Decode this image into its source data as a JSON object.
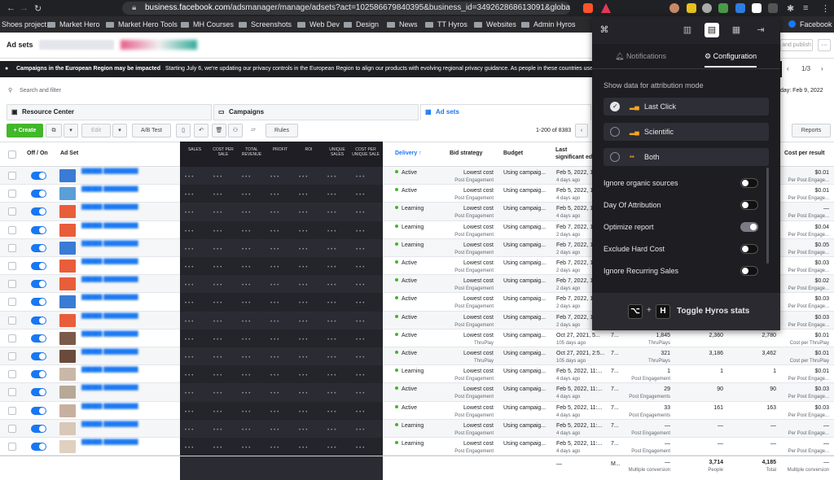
{
  "browser": {
    "url_host": "business.facebook.com",
    "url_path": "/adsmanager/manage/adsets?act=102586679840395&business_id=349262868613091&global...",
    "bookmarks": [
      "Shoes project",
      "Market Hero",
      "Market Hero Tools",
      "MH Courses",
      "Screenshots",
      "Web Dev",
      "Design",
      "News",
      "TT Hyros",
      "Websites",
      "Admin Hyros",
      "Facebook"
    ]
  },
  "header": {
    "title": "Ad sets",
    "publish_label": "and publish",
    "more": "···"
  },
  "banner": {
    "title": "Campaigns in the European Region may be impacted",
    "text": "Starting July 6, we're updating our privacy controls in the European Region to align our products with evolving regional privacy guidance. As people in these countries use our new c"
  },
  "pager": {
    "label": "1/3"
  },
  "search": {
    "placeholder": "Search and filter",
    "date": "day: Feb 9, 2022"
  },
  "tabs": {
    "resource": "Resource Center",
    "campaigns": "Campaigns",
    "adsets": "Ad sets"
  },
  "toolbar": {
    "create": "+ Create",
    "edit": "Edit",
    "ab_test": "A/B Test",
    "rules": "Rules",
    "count": "1-200 of 8383",
    "reports": "Reports"
  },
  "columns": {
    "onoff": "Off / On",
    "adset": "Ad Set",
    "delivery": "Delivery ↑",
    "bid": "Bid strategy",
    "budget": "Budget",
    "last_edit": "Last significant edit",
    "cost_per_result": "Cost per result"
  },
  "dark_columns": [
    "SALES",
    "COST PER SALE",
    "TOTAL REVENUE",
    "PROFIT",
    "ROI",
    "UNIQUE SALES",
    "COST PER UNIQUE SALE"
  ],
  "rows": [
    {
      "delivery": "Active",
      "status": "active",
      "bid": "Lowest cost",
      "bid_sub": "Post Engagement",
      "budget": "Using campaig...",
      "edit": "Feb 5, 2022, 12...",
      "edit_sub": "4 days ago",
      "c7": "",
      "result": "",
      "result_sub": "",
      "reach": "",
      "impr": "",
      "cpr": "$0.01",
      "cpr_sub": "Per Post Engage...",
      "thumb": "#3a7bd5"
    },
    {
      "delivery": "Active",
      "status": "active",
      "bid": "Lowest cost",
      "bid_sub": "Post Engagement",
      "budget": "Using campaig...",
      "edit": "Feb 5, 2022, 12...",
      "edit_sub": "4 days ago",
      "c7": "",
      "result": "",
      "result_sub": "",
      "reach": "",
      "impr": "",
      "cpr": "$0.01",
      "cpr_sub": "Per Post Engage...",
      "thumb": "#5a9fd6"
    },
    {
      "delivery": "Learning",
      "status": "learning",
      "bid": "Lowest cost",
      "bid_sub": "Post Engagement",
      "budget": "Using campaig...",
      "edit": "Feb 5, 2022, 12...",
      "edit_sub": "4 days ago",
      "c7": "",
      "result": "",
      "result_sub": "",
      "reach": "",
      "impr": "",
      "cpr": "—",
      "cpr_sub": "Per Post Engage...",
      "thumb": "#e85d3a"
    },
    {
      "delivery": "Learning",
      "status": "learning",
      "bid": "Lowest cost",
      "bid_sub": "Post Engagement",
      "budget": "Using campaig...",
      "edit": "Feb 7, 2022, 10...",
      "edit_sub": "2 days ago",
      "c7": "",
      "result": "",
      "result_sub": "",
      "reach": "",
      "impr": "",
      "cpr": "$0.04",
      "cpr_sub": "Per Post Engage...",
      "thumb": "#e85d3a"
    },
    {
      "delivery": "Learning",
      "status": "learning",
      "bid": "Lowest cost",
      "bid_sub": "Post Engagement",
      "budget": "Using campaig...",
      "edit": "Feb 7, 2022, 10...",
      "edit_sub": "2 days ago",
      "c7": "",
      "result": "",
      "result_sub": "",
      "reach": "",
      "impr": "",
      "cpr": "$0.05",
      "cpr_sub": "Per Post Engage...",
      "thumb": "#3a7bd5"
    },
    {
      "delivery": "Active",
      "status": "active",
      "bid": "Lowest cost",
      "bid_sub": "Post Engagement",
      "budget": "Using campaig...",
      "edit": "Feb 7, 2022, 10...",
      "edit_sub": "2 days ago",
      "c7": "",
      "result": "",
      "result_sub": "",
      "reach": "",
      "impr": "",
      "cpr": "$0.03",
      "cpr_sub": "Per Post Engage...",
      "thumb": "#e85d3a"
    },
    {
      "delivery": "Active",
      "status": "active",
      "bid": "Lowest cost",
      "bid_sub": "Post Engagement",
      "budget": "Using campaig...",
      "edit": "Feb 7, 2022, 10...",
      "edit_sub": "2 days ago",
      "c7": "",
      "result": "",
      "result_sub": "",
      "reach": "",
      "impr": "",
      "cpr": "$0.02",
      "cpr_sub": "Per Post Engage...",
      "thumb": "#e85d3a"
    },
    {
      "delivery": "Active",
      "status": "active",
      "bid": "Lowest cost",
      "bid_sub": "Post Engagement",
      "budget": "Using campaig...",
      "edit": "Feb 7, 2022, 10...",
      "edit_sub": "2 days ago",
      "c7": "",
      "result": "",
      "result_sub": "",
      "reach": "",
      "impr": "",
      "cpr": "$0.03",
      "cpr_sub": "Per Post Engage...",
      "thumb": "#3a7bd5"
    },
    {
      "delivery": "Active",
      "status": "active",
      "bid": "Lowest cost",
      "bid_sub": "Post Engagement",
      "budget": "Using campaig...",
      "edit": "Feb 7, 2022, 10...",
      "edit_sub": "2 days ago",
      "c7": "",
      "result": "",
      "result_sub": "",
      "reach": "",
      "impr": "",
      "cpr": "$0.03",
      "cpr_sub": "Per Post Engage...",
      "thumb": "#e85d3a"
    },
    {
      "delivery": "Active",
      "status": "active",
      "bid": "Lowest cost",
      "bid_sub": "ThruPlay",
      "budget": "Using campaig...",
      "edit": "Oct 27, 2021, 5...",
      "edit_sub": "105 days ago",
      "c7": "7...",
      "result": "1,845",
      "result_sub": "ThruPlays",
      "reach": "2,360",
      "impr": "2,780",
      "cpr": "$0.01",
      "cpr_sub": "Cost per ThruPlay",
      "thumb": "#7a5a4a"
    },
    {
      "delivery": "Active",
      "status": "active",
      "bid": "Lowest cost",
      "bid_sub": "ThruPlay",
      "budget": "Using campaig...",
      "edit": "Oct 27, 2021, 2:5...",
      "edit_sub": "105 days ago",
      "c7": "7...",
      "result": "321",
      "result_sub": "ThruPlays",
      "reach": "3,186",
      "impr": "3,462",
      "cpr": "$0.01",
      "cpr_sub": "Cost per ThruPlay",
      "thumb": "#6a4a3a"
    },
    {
      "delivery": "Learning",
      "status": "learning",
      "bid": "Lowest cost",
      "bid_sub": "Post Engagement",
      "budget": "Using campaig...",
      "edit": "Feb 5, 2022, 11:...",
      "edit_sub": "4 days ago",
      "c7": "7...",
      "result": "1",
      "result_sub": "Post Engagement",
      "reach": "1",
      "impr": "1",
      "cpr": "$0.01",
      "cpr_sub": "Per Post Engage...",
      "thumb": "#c9b8a8"
    },
    {
      "delivery": "Active",
      "status": "active",
      "bid": "Lowest cost",
      "bid_sub": "Post Engagement",
      "budget": "Using campaig...",
      "edit": "Feb 5, 2022, 11:...",
      "edit_sub": "4 days ago",
      "c7": "7...",
      "result": "29",
      "result_sub": "Post Engagements",
      "reach": "90",
      "impr": "90",
      "cpr": "$0.03",
      "cpr_sub": "Per Post Engage...",
      "thumb": "#b8a898"
    },
    {
      "delivery": "Active",
      "status": "active",
      "bid": "Lowest cost",
      "bid_sub": "Post Engagement",
      "budget": "Using campaig...",
      "edit": "Feb 5, 2022, 11:...",
      "edit_sub": "4 days ago",
      "c7": "7...",
      "result": "33",
      "result_sub": "Post Engagements",
      "reach": "161",
      "impr": "163",
      "cpr": "$0.03",
      "cpr_sub": "Per Post Engage...",
      "thumb": "#c8b0a0"
    },
    {
      "delivery": "Learning",
      "status": "learning",
      "bid": "Lowest cost",
      "bid_sub": "Post Engagement",
      "budget": "Using campaig...",
      "edit": "Feb 5, 2022, 11:...",
      "edit_sub": "4 days ago",
      "c7": "7...",
      "result": "—",
      "result_sub": "Post Engagement",
      "reach": "—",
      "impr": "—",
      "cpr": "—",
      "cpr_sub": "Per Post Engage...",
      "thumb": "#d8c8b8"
    },
    {
      "delivery": "Learning",
      "status": "learning",
      "bid": "Lowest cost",
      "bid_sub": "Post Engagement",
      "budget": "Using campaig...",
      "edit": "Feb 5, 2022, 11:...",
      "edit_sub": "4 days ago",
      "c7": "7...",
      "result": "—",
      "result_sub": "Post Engagement",
      "reach": "—",
      "impr": "—",
      "cpr": "—",
      "cpr_sub": "Per Post Engage...",
      "thumb": "#e0d0c0"
    }
  ],
  "footer": {
    "edit": "—",
    "c7": "M...",
    "result": "—",
    "result_sub": "Multiple conversion",
    "reach": "3,714",
    "reach_sub": "People",
    "impr": "4,185",
    "impr_sub": "Total",
    "cpr": "—",
    "cpr_sub": "Multiple conversion"
  },
  "panel": {
    "tab_notifications": "Notifications",
    "tab_configuration": "Configuration",
    "attribution_label": "Show data for attribution mode",
    "modes": [
      {
        "label": "Last Click",
        "selected": true
      },
      {
        "label": "Scientific",
        "selected": false
      },
      {
        "label": "Both",
        "selected": false
      }
    ],
    "options": [
      {
        "label": "Ignore organic sources",
        "on": false
      },
      {
        "label": "Day Of Attribution",
        "on": false
      },
      {
        "label": "Optimize report",
        "on": true
      },
      {
        "label": "Exclude Hard Cost",
        "on": false
      },
      {
        "label": "Ignore Recurring Sales",
        "on": false
      }
    ],
    "key1": "⌥",
    "plus": "+",
    "key2": "H",
    "toggle_label": "Toggle Hyros stats"
  },
  "colors": {
    "accent": "#1877f2",
    "active": "#42b72a",
    "learning": "#42b72a",
    "panel": "#1d1d22"
  }
}
